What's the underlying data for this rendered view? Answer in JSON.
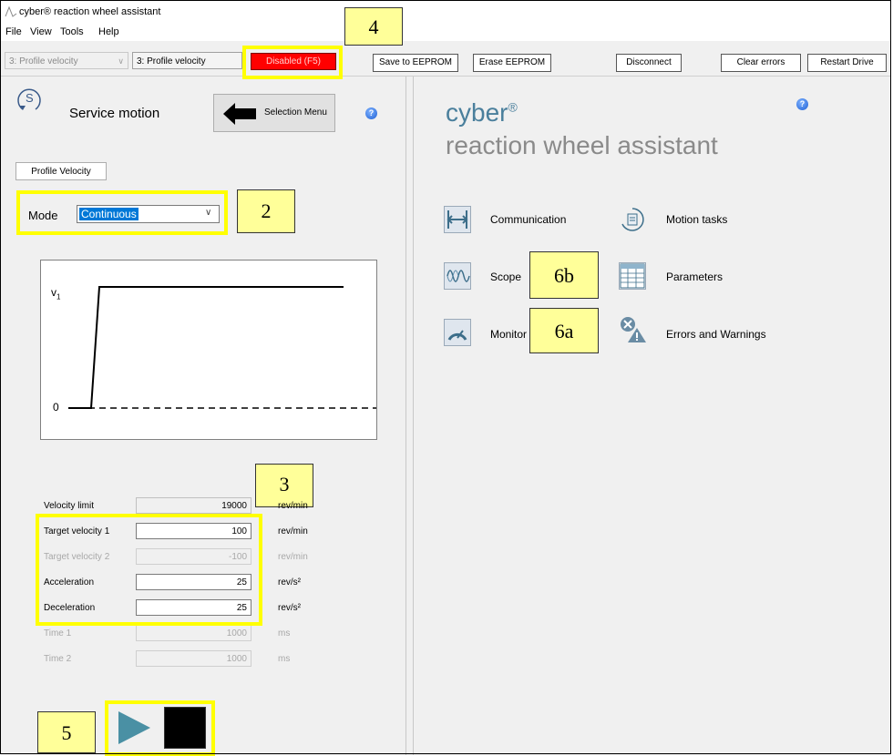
{
  "window": {
    "title": "cyber® reaction wheel assistant"
  },
  "menu": [
    "File",
    "View",
    "Tools",
    "Help"
  ],
  "toolbar": {
    "mode_combo_disabled": "3: Profile velocity",
    "mode_combo": "3: Profile velocity",
    "enable_button": "Disabled (F5)",
    "save_eeprom": "Save to EEPROM",
    "erase_eeprom": "Erase EEPROM",
    "disconnect": "Disconnect",
    "clear_errors": "Clear errors",
    "restart_drive": "Restart Drive"
  },
  "service": {
    "icon_letter": "S",
    "title": "Service motion",
    "selection_menu": "Selection Menu",
    "tab": "Profile Velocity",
    "mode_label": "Mode",
    "mode_value": "Continuous"
  },
  "profile_chart": {
    "label_v1": "v",
    "label_v1_sub": "1",
    "label_zero": "0"
  },
  "params": [
    {
      "label": "Velocity limit",
      "value": "19000",
      "unit": "rev/min",
      "state": "readonly"
    },
    {
      "label": "Target velocity 1",
      "value": "100",
      "unit": "rev/min",
      "state": "active"
    },
    {
      "label": "Target velocity 2",
      "value": "-100",
      "unit": "rev/min",
      "state": "disabled"
    },
    {
      "label": "Acceleration",
      "value": "25",
      "unit": "rev/s²",
      "state": "active"
    },
    {
      "label": "Deceleration",
      "value": "25",
      "unit": "rev/s²",
      "state": "active"
    },
    {
      "label": "Time 1",
      "value": "1000",
      "unit": "ms",
      "state": "disabled"
    },
    {
      "label": "Time 2",
      "value": "1000",
      "unit": "ms",
      "state": "disabled"
    }
  ],
  "brand": {
    "line1": "cyber",
    "line1_mark": "®",
    "line2": "reaction wheel assistant"
  },
  "nav": {
    "communication": "Communication",
    "motion_tasks": "Motion tasks",
    "scope": "Scope",
    "parameters": "Parameters",
    "monitor": "Monitor",
    "errors_warnings": "Errors and Warnings"
  },
  "callouts": {
    "c2": "2",
    "c3": "3",
    "c4": "4",
    "c5": "5",
    "c6a": "6a",
    "c6b": "6b"
  },
  "help_glyph": "?",
  "colors": {
    "highlight": "#ffff00",
    "callout_bg": "#ffff99",
    "disabled_red": "#ff0000",
    "play_teal": "#4a90a4"
  }
}
